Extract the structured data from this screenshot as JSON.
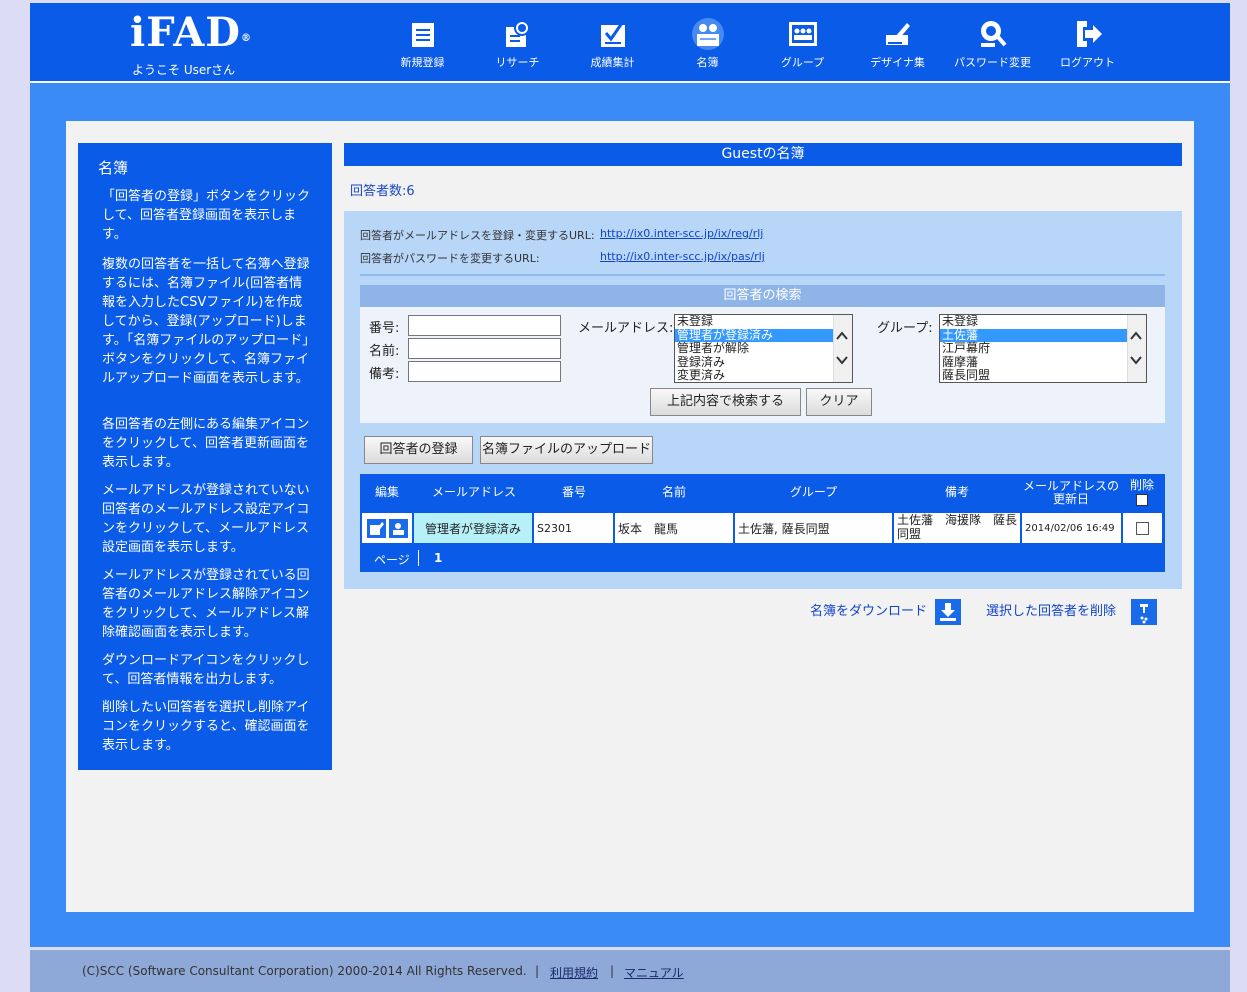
{
  "header": {
    "logo": "iFAD",
    "logo_mark": "®",
    "welcome": "ようこそ Userさん",
    "nav": [
      {
        "label": "新規登録",
        "icon": "new-entry-icon"
      },
      {
        "label": "リサーチ",
        "icon": "research-icon"
      },
      {
        "label": "成績集計",
        "icon": "grade-summary-icon"
      },
      {
        "label": "名簿",
        "icon": "roster-icon",
        "active": true
      },
      {
        "label": "グループ",
        "icon": "group-icon"
      },
      {
        "label": "デザイナ集",
        "icon": "designer-icon"
      },
      {
        "label": "パスワード変更",
        "icon": "password-change-icon"
      },
      {
        "label": "ログアウト",
        "icon": "logout-icon"
      }
    ]
  },
  "sidebar": {
    "title": "名簿",
    "help": [
      "「回答者の登録」ボタンをクリックして、回答者登録画面を表示します。",
      "複数の回答者を一括して名簿へ登録するには、名簿ファイル(回答者情報を入力したCSVファイル)を作成してから、登録(アップロード)します。「名簿ファイルのアップロード」ボタンをクリックして、名簿ファイルアップロード画面を表示します。",
      "各回答者の左側にある編集アイコンをクリックして、回答者更新画面を表示します。",
      "メールアドレスが登録されていない回答者のメールアドレス設定アイコンをクリックして、メールアドレス設定画面を表示します。",
      "メールアドレスが登録されている回答者のメールアドレス解除アイコンをクリックして、メールアドレス解除確認画面を表示します。",
      "ダウンロードアイコンをクリックして、回答者情報を出力します。",
      "削除したい回答者を選択し削除アイコンをクリックすると、確認画面を表示します。"
    ]
  },
  "main": {
    "title": "Guestの名簿",
    "count_label": "回答者数:6",
    "url_email_label": "回答者がメールアドレスを登録・変更するURL:",
    "url_email": "http://ix0.inter-scc.jp/ix/reg/rlj",
    "url_pass_label": "回答者がパスワードを変更するURL:",
    "url_pass": "http://ix0.inter-scc.jp/ix/pas/rlj"
  },
  "search": {
    "title": "回答者の検索",
    "number_label": "番号:",
    "name_label": "名前:",
    "note_label": "備考:",
    "number_value": "",
    "name_value": "",
    "note_value": "",
    "email_label": "メールアドレス:",
    "email_options": [
      "未登録",
      "管理者が登録済み",
      "管理者が解除",
      "登録済み",
      "変更済み"
    ],
    "email_selected": "管理者が登録済み",
    "group_label": "グループ:",
    "group_options": [
      "未登録",
      "土佐藩",
      "江戸幕府",
      "薩摩藩",
      "薩長同盟"
    ],
    "group_selected": "土佐藩",
    "search_button": "上記内容で検索する",
    "clear_button": "クリア"
  },
  "actions": {
    "register_button": "回答者の登録",
    "upload_button": "名簿ファイルのアップロード"
  },
  "table": {
    "headers": {
      "edit": "編集",
      "email": "メールアドレス",
      "number": "番号",
      "name": "名前",
      "group": "グループ",
      "note": "備考",
      "updated": "メールアドレスの更新日",
      "delete": "削除"
    },
    "rows": [
      {
        "email_status": "管理者が登録済み",
        "number": "S2301",
        "name": "坂本　龍馬",
        "group": "土佐藩, 薩長同盟",
        "note": "土佐藩　海援隊　薩長同盟",
        "updated": "2014/02/06 16:49",
        "checked": false
      }
    ],
    "page_label": "ページ",
    "page_number": "1"
  },
  "bottom": {
    "download_label": "名簿をダウンロード",
    "delete_label": "選択した回答者を削除"
  },
  "footer": {
    "copyright": "(C)SCC (Software Consultant Corporation) 2000-2014 All Rights Reserved.",
    "terms": "利用規約",
    "manual": "マニュアル"
  },
  "colors": {
    "primary": "#0a5be8",
    "background": "#3a8bf5",
    "highlight": "#3399ff",
    "status_cell": "#b6f0f8"
  }
}
